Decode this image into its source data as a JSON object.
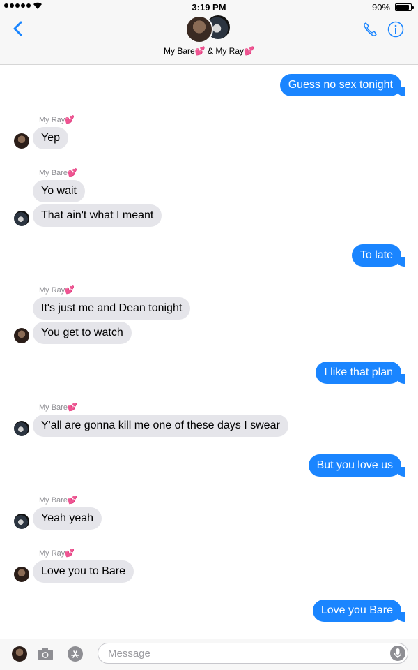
{
  "status_bar": {
    "time": "3:19 PM",
    "battery_percent": "90%",
    "battery_level": 0.9,
    "signal_bars": 5
  },
  "header": {
    "title": "My Bare💕 & My Ray💕",
    "back_icon": "chevron-left-icon",
    "phone_icon": "phone-icon",
    "info_icon": "info-icon",
    "accent_color": "#1a85ff"
  },
  "messages": [
    {
      "direction": "out",
      "text": "Guess no sex tonight"
    },
    {
      "direction": "in",
      "sender": "My Ray💕",
      "text": "Yep"
    },
    {
      "direction": "in",
      "sender": "My Bare💕",
      "text": "Yo wait"
    },
    {
      "direction": "in",
      "text": "That ain't what I meant"
    },
    {
      "direction": "out",
      "text": "To late"
    },
    {
      "direction": "in",
      "sender": "My Ray💕",
      "text": "It's just me and Dean tonight"
    },
    {
      "direction": "in",
      "text": "You get to watch"
    },
    {
      "direction": "out",
      "text": "I like that plan"
    },
    {
      "direction": "in",
      "sender": "My Bare💕",
      "text": "Y'all are gonna kill me one of these days I swear"
    },
    {
      "direction": "out",
      "text": "But you love us"
    },
    {
      "direction": "in",
      "sender": "My Bare💕",
      "text": "Yeah yeah"
    },
    {
      "direction": "in",
      "sender": "My Ray💕",
      "text": "Love you to Bare"
    },
    {
      "direction": "out",
      "text": "Love you Bare"
    }
  ],
  "composer": {
    "placeholder": "Message",
    "camera_icon": "camera-icon",
    "appstore_icon": "app-store-icon",
    "mic_icon": "microphone-icon"
  }
}
